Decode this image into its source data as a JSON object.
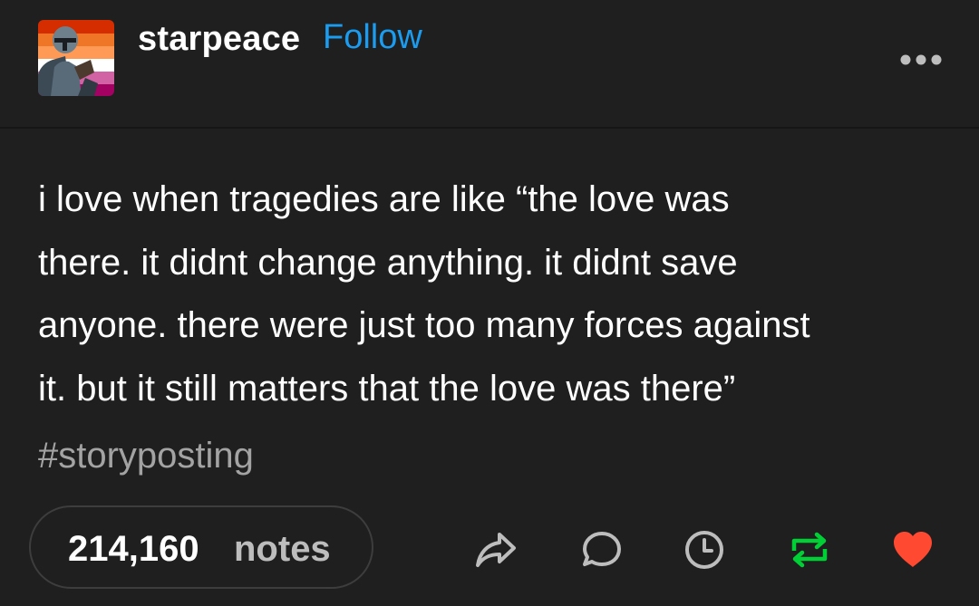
{
  "header": {
    "username": "starpeace",
    "follow_label": "Follow"
  },
  "post": {
    "text": "i love when tragedies are like “the love was\nthere. it didnt change anything. it didnt save\nanyone. there were just too many forces against\nit. but it still matters that the love was there”",
    "tag": "#storyposting"
  },
  "footer": {
    "notes_count": "214,160",
    "notes_word": "notes"
  },
  "icons": {
    "more": "more-options-icon",
    "share": "share-icon",
    "reply": "reply-icon",
    "queue": "clock-icon",
    "reblog": "reblog-icon",
    "like": "heart-icon"
  },
  "colors": {
    "background": "#1f1f1f",
    "follow_link": "#1a9cf0",
    "reblog": "#00cf35",
    "like": "#ff4930",
    "tag": "#a3a3a3"
  }
}
